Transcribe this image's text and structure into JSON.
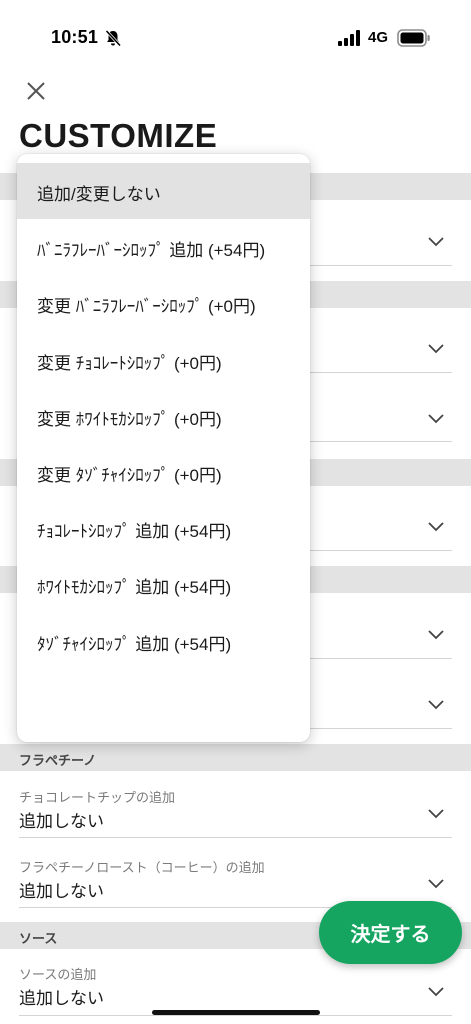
{
  "status_bar": {
    "time": "10:51",
    "network": "4G"
  },
  "header": {
    "title": "CUSTOMIZE"
  },
  "dropdown": {
    "options": [
      {
        "label": "追加/変更しない",
        "selected": true
      },
      {
        "label": "ﾊﾞﾆﾗﾌﾚｰﾊﾞｰｼﾛｯﾌﾟ 追加 (+54円)"
      },
      {
        "label": "変更 ﾊﾞﾆﾗﾌﾚｰﾊﾞｰｼﾛｯﾌﾟ (+0円)"
      },
      {
        "label": "変更 ﾁｮｺﾚｰﾄｼﾛｯﾌﾟ (+0円)"
      },
      {
        "label": "変更 ﾎﾜｲﾄﾓｶｼﾛｯﾌﾟ (+0円)"
      },
      {
        "label": "変更 ﾀｿﾞﾁｬｲｼﾛｯﾌﾟ (+0円)"
      },
      {
        "label": "ﾁｮｺﾚｰﾄｼﾛｯﾌﾟ 追加 (+54円)"
      },
      {
        "label": "ﾎﾜｲﾄﾓｶｼﾛｯﾌﾟ 追加 (+54円)"
      },
      {
        "label": "ﾀｿﾞﾁｬｲｼﾛｯﾌﾟ 追加 (+54円)"
      }
    ]
  },
  "sections": {
    "frappuccino": {
      "title": "フラペチーノ",
      "rows": [
        {
          "label": "チョコレートチップの追加",
          "value": "追加しない"
        },
        {
          "label": "フラペチーノロースト（コーヒー）の追加",
          "value": "追加しない"
        }
      ]
    },
    "sauce": {
      "title": "ソース",
      "rows": [
        {
          "label": "ソースの追加",
          "value": "追加しない"
        }
      ]
    }
  },
  "actions": {
    "submit_label": "決定する"
  },
  "colors": {
    "accent": "#15a561",
    "section_bg": "#e3e3e3",
    "selected_bg": "#e2e2e2"
  }
}
